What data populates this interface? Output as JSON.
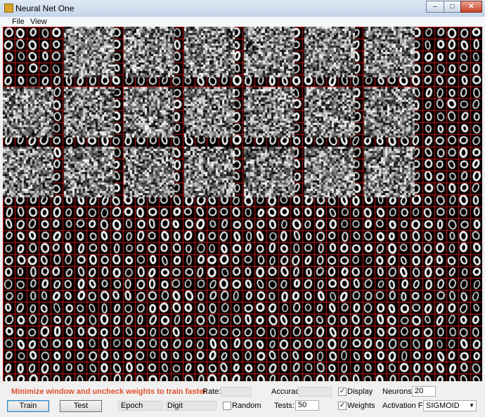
{
  "window": {
    "title": "Neural Net One",
    "controls": {
      "minimize": "–",
      "maximize": "□",
      "close": "✕"
    }
  },
  "menu": [
    {
      "label": "File"
    },
    {
      "label": "View"
    }
  ],
  "visualization": {
    "grid_line_color": "#d01616",
    "description_cells": "digit '0' training images and weight noise maps"
  },
  "status": {
    "message": "Minimize window and uncheck weights to train faster",
    "message_color": "#e0522e"
  },
  "controls": {
    "rate_label": "Rate:",
    "rate_value": "",
    "accuracy_label": "Accuracy:",
    "accuracy_value": "",
    "display_label": "Display",
    "display_checked": true,
    "neurons_label": "Neurons:",
    "neurons_value": "20",
    "train_button": "Train",
    "test_button": "Test",
    "epoch_label": "Epoch",
    "digit_label": "Digit",
    "random_label": "Random",
    "random_checked": false,
    "tests_label": "Tests:",
    "tests_value": "50",
    "weights_label": "Weights",
    "weights_checked": true,
    "activation_label": "Activation Fn:",
    "activation_value": "SIGMOID"
  }
}
